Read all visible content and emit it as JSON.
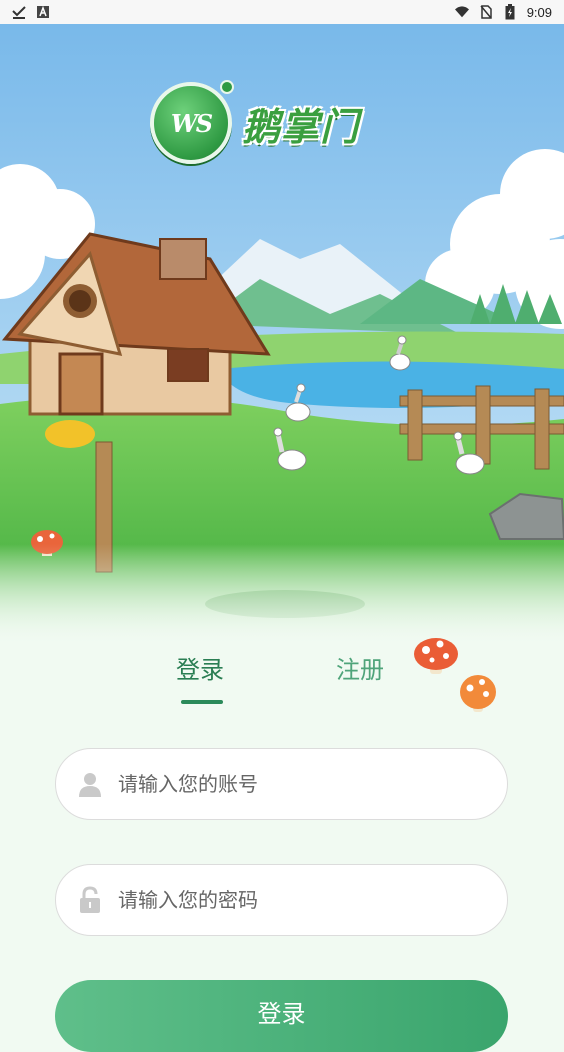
{
  "status_bar": {
    "time": "9:09",
    "left_icons": [
      "check-download-icon",
      "a-box-icon"
    ],
    "right_icons": [
      "wifi-icon",
      "no-sim-icon",
      "battery-icon"
    ]
  },
  "app": {
    "logo_text": "鹅掌门",
    "logo_badge_text": "WS"
  },
  "tabs": {
    "login": "登录",
    "register": "注册",
    "active": "login"
  },
  "form": {
    "account_placeholder": "请输入您的账号",
    "password_placeholder": "请输入您的密码",
    "submit_label": "登录"
  },
  "colors": {
    "brand_green": "#3a9f3f",
    "tab_active": "#2a7e53",
    "button": "#3aa56d"
  }
}
